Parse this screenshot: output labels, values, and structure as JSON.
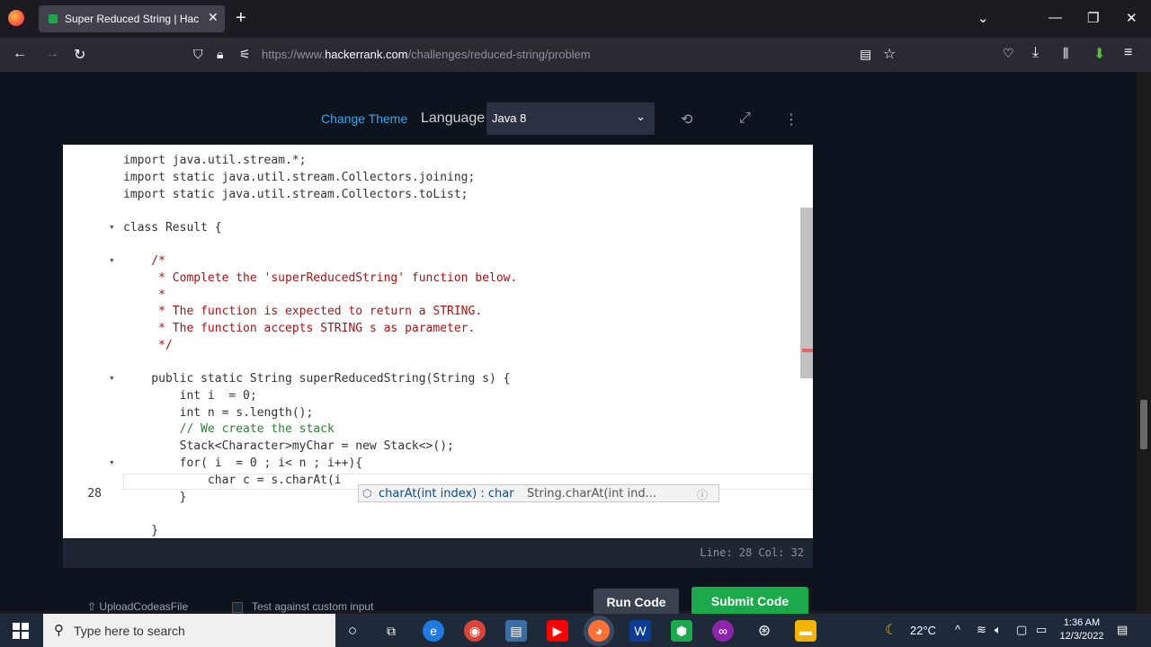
{
  "browser": {
    "tab_title": "Super Reduced String | HackerRank",
    "tab_close": "✕",
    "new_tab": "+",
    "url_prefix": "https://www.",
    "url_domain": "hackerrank.com",
    "url_path": "/challenges/reduced-string/problem"
  },
  "toolbar": {
    "change_theme": "Change Theme",
    "language_label": "Language",
    "language_value": "Java 8"
  },
  "editor": {
    "lines": [
      {
        "text": "import java.util.stream.*;"
      },
      {
        "text": "import static java.util.stream.Collectors.joining;"
      },
      {
        "text": "import static java.util.stream.Collectors.toList;"
      },
      {
        "text": ""
      },
      {
        "text": "class Result {"
      },
      {
        "text": ""
      },
      {
        "text": "    /*"
      },
      {
        "text": "     * Complete the 'superReducedString' function below."
      },
      {
        "text": "     *"
      },
      {
        "text": "     * The function is expected to return a STRING."
      },
      {
        "text": "     * The function accepts STRING s as parameter."
      },
      {
        "text": "     */"
      },
      {
        "text": ""
      },
      {
        "text": "    public static String superReducedString(String s) {"
      },
      {
        "text": "        int i  = 0;"
      },
      {
        "text": "        int n = s.length();"
      },
      {
        "text": "        // We create the stack"
      },
      {
        "text": "        Stack<Character>myChar = new Stack<>();"
      },
      {
        "text": "        for( i  = 0 ; i< n ; i++){"
      },
      {
        "text": "            char c = s.charAt(i"
      },
      {
        "text": "        }"
      },
      {
        "text": ""
      },
      {
        "text": "    }"
      }
    ],
    "active_line_number": "28",
    "cursor_status": "Line: 28 Col: 32"
  },
  "autocomplete": {
    "main": "charAt(int index) : char",
    "detail": "String.charAt(int ind...",
    "info_icon": "ⓘ"
  },
  "actions": {
    "upload": "UploadCodeasFile",
    "custom_input": "Test against custom input",
    "run": "Run Code",
    "submit": "Submit Code"
  },
  "taskbar": {
    "search_placeholder": "Type here to search",
    "temperature": "22°C",
    "time": "1:36 AM",
    "date": "12/3/2022"
  }
}
